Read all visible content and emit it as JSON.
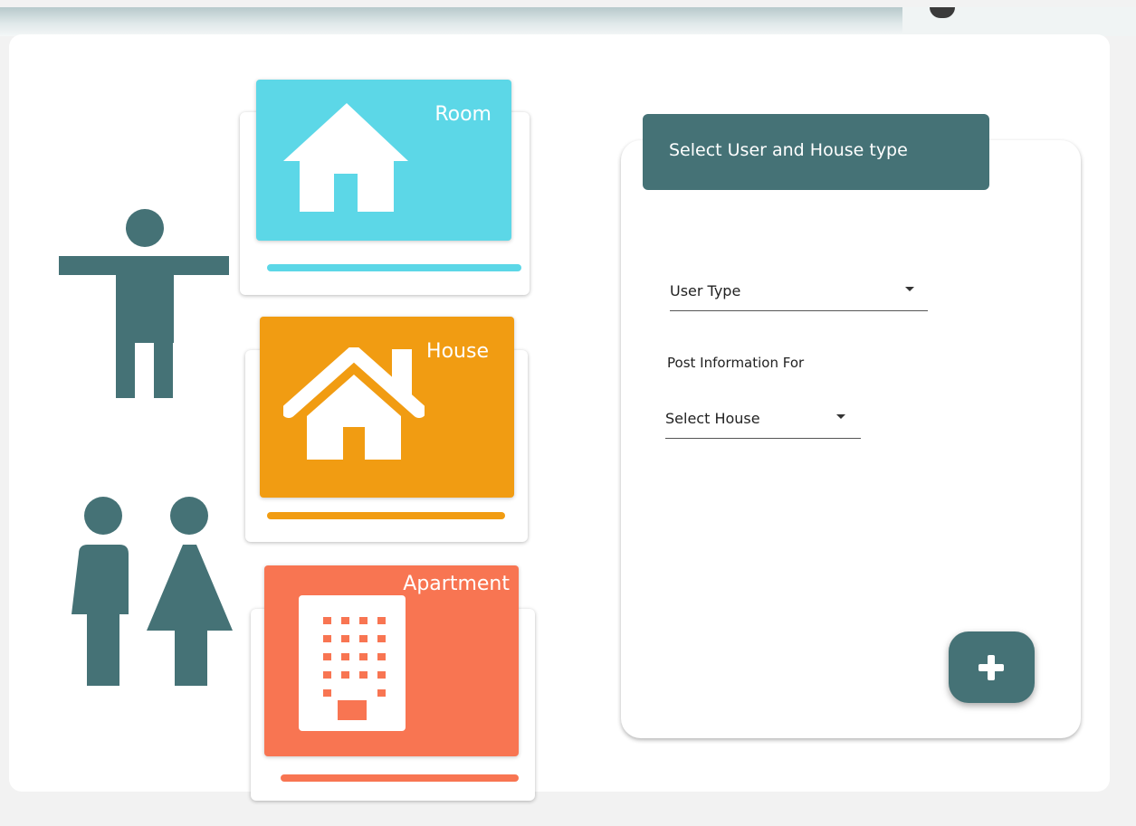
{
  "colors": {
    "teal": "#457276",
    "room": "#5cd7e7",
    "house": "#f19c12",
    "apartment": "#f87552"
  },
  "cards": {
    "room": {
      "title": "Room",
      "icon": "house-icon"
    },
    "house": {
      "title": "House",
      "icon": "house-chimney-icon"
    },
    "apartment": {
      "title": "Apartment",
      "icon": "building-icon"
    }
  },
  "figures": {
    "single": "person-arms-out-icon",
    "couple": "man-woman-icon"
  },
  "form": {
    "header": "Select User and House type",
    "user_type": "User Type",
    "post_label": "Post Information For",
    "select_house": "Select House",
    "add_button_icon": "plus-icon"
  }
}
